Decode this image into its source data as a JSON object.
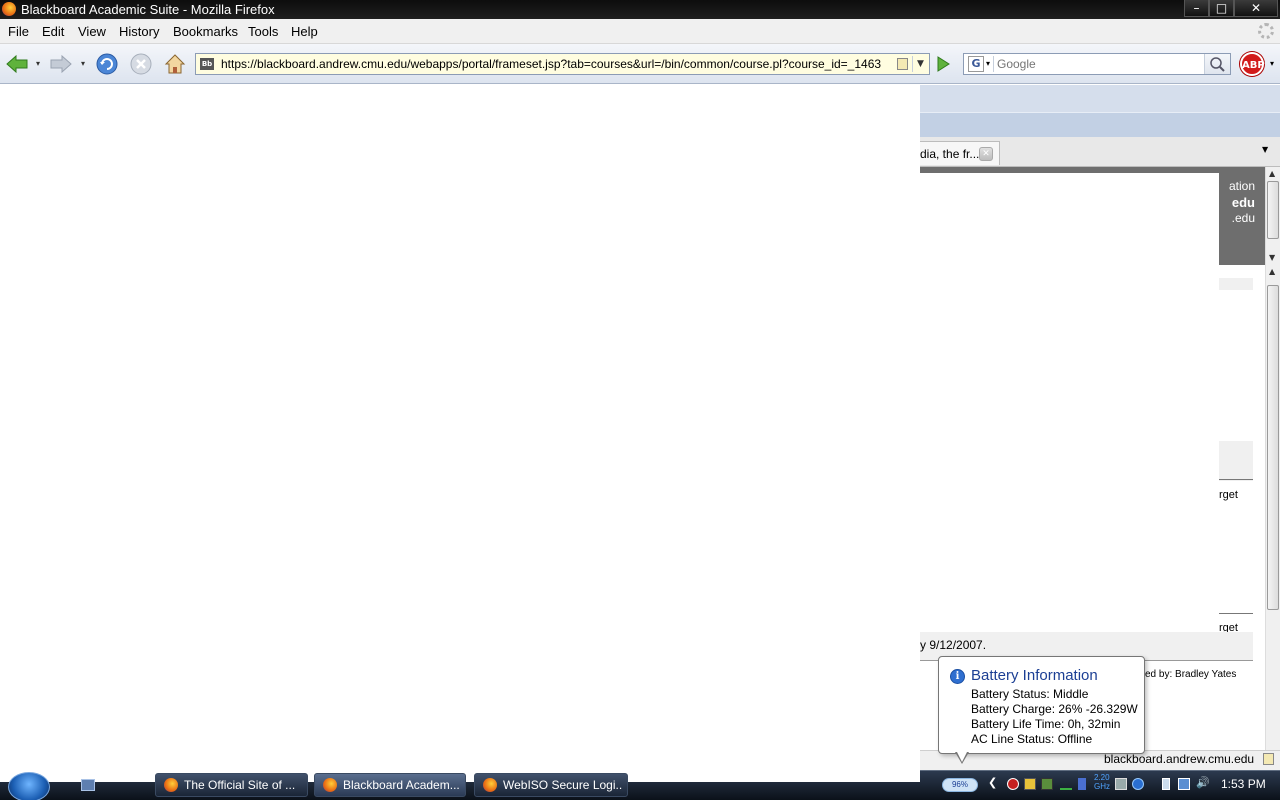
{
  "window": {
    "title": "Blackboard Academic Suite - Mozilla Firefox"
  },
  "menu": [
    "File",
    "Edit",
    "View",
    "History",
    "Bookmarks",
    "Tools",
    "Help"
  ],
  "navbar": {
    "url": "https://blackboard.andrew.cmu.edu/webapps/portal/frameset.jsp?tab=courses&url=/bin/common/course.pl?course_id=_1463",
    "favicon_text": "Bb",
    "search_placeholder": "Google",
    "search_engine": "G",
    "adblock_label": "ABP"
  },
  "tab": {
    "label": "dia, the fr..."
  },
  "header_frag": {
    "line1": "ation",
    "line2": "edu",
    "line3": ".edu"
  },
  "content_frags": {
    "forget1": "rget",
    "forget2": "rget",
    "date_text": "y 9/12/2007.",
    "posted_by": "ed by: Bradley Yates"
  },
  "balloon": {
    "title": "Battery Information",
    "lines": [
      "Battery Status: Middle",
      "Battery Charge: 26%  -26.329W",
      "Battery Life Time: 0h, 32min",
      "AC Line Status: Offline"
    ]
  },
  "status": {
    "host": "blackboard.andrew.cmu.edu"
  },
  "taskbar": {
    "tasks": [
      "The Official Site of ...",
      "Blackboard Academ...",
      "WebISO Secure Logi..."
    ],
    "battery_text": "96%",
    "cpu_text": [
      "2.20",
      "GHz"
    ],
    "clock": "1:53 PM"
  },
  "colors": {
    "accent": "#1c3f94",
    "abp": "#d21b1b",
    "url_bg": "#fffde0"
  }
}
